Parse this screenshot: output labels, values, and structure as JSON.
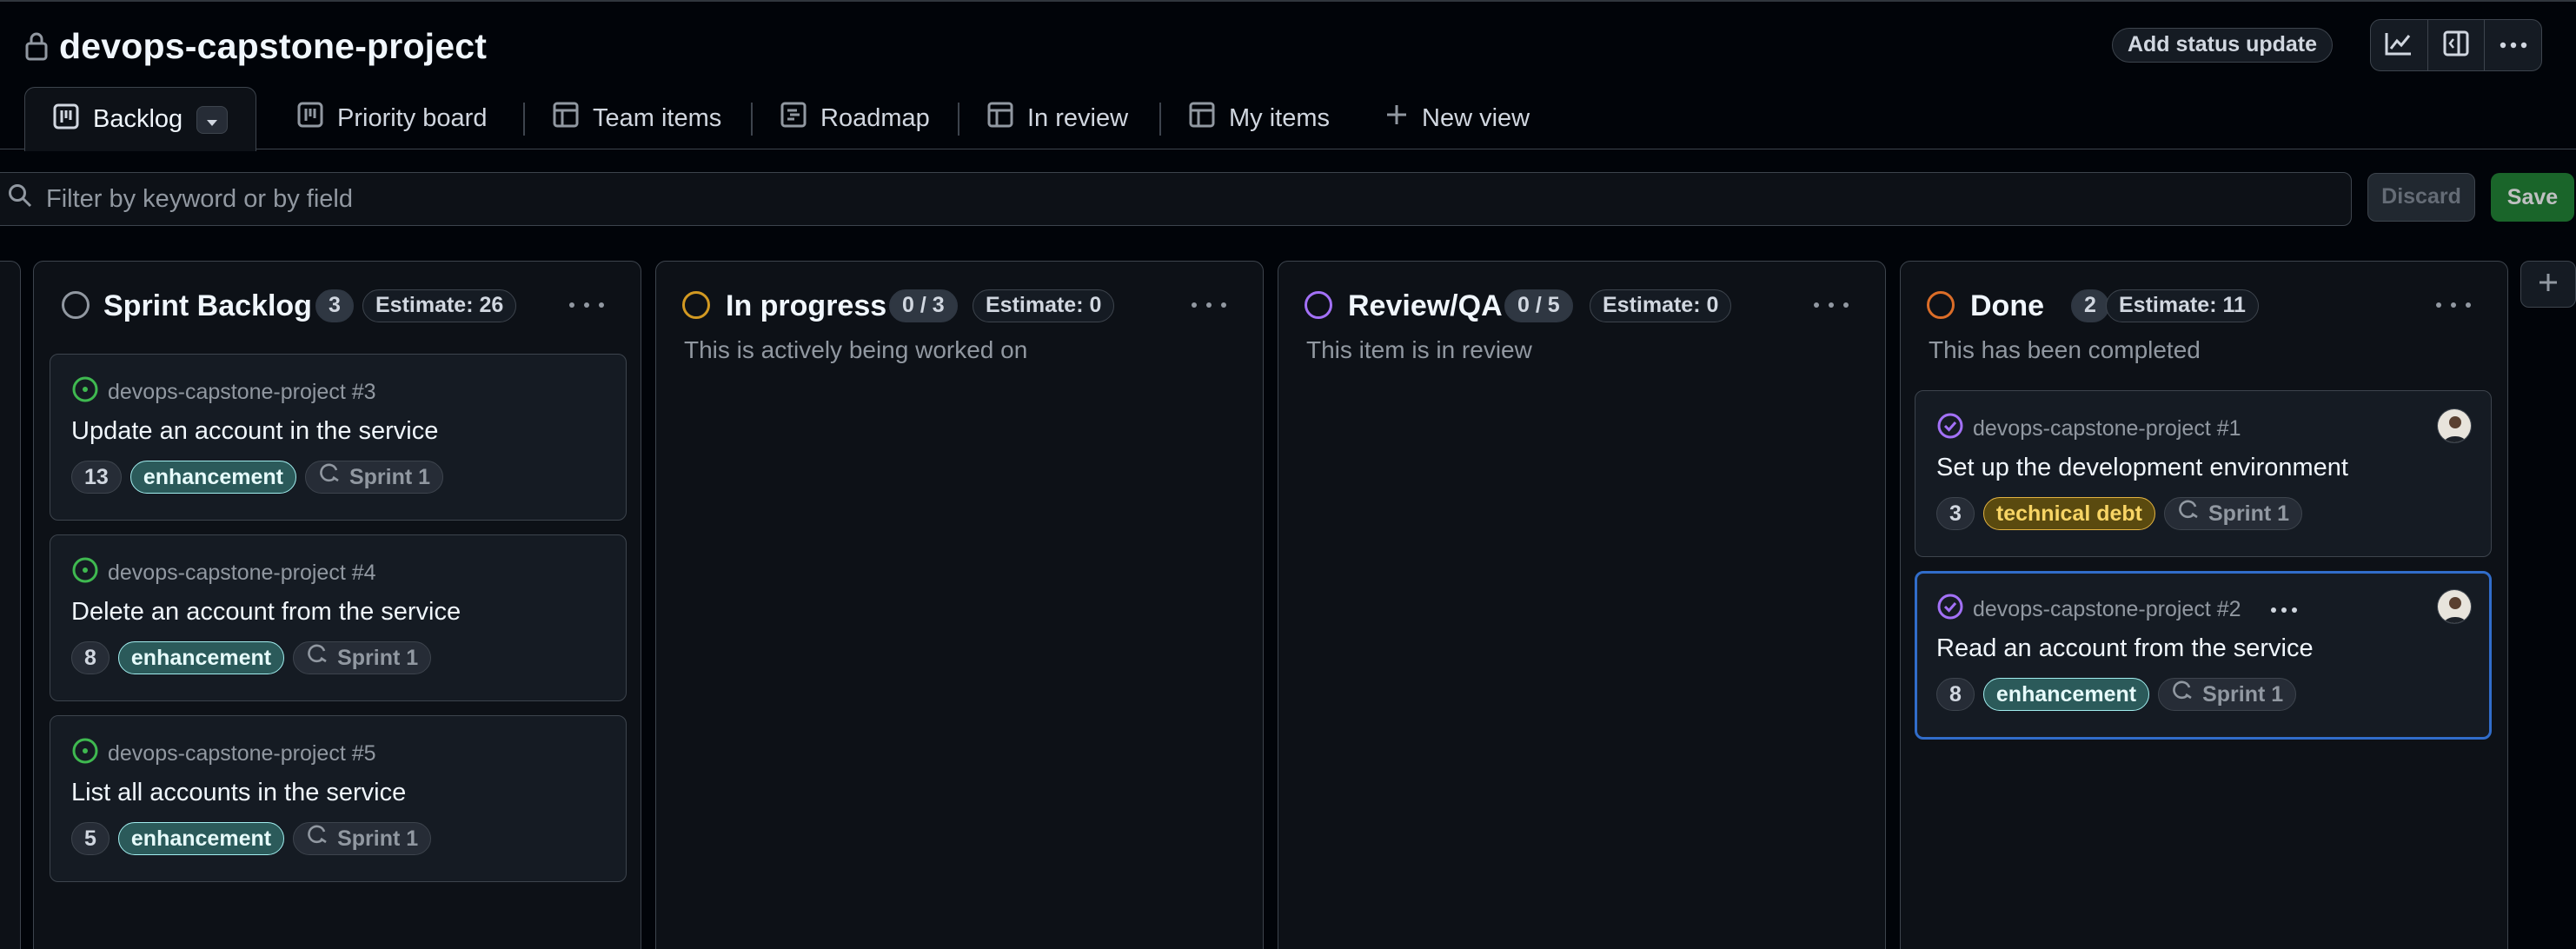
{
  "project": {
    "title": "devops-capstone-project"
  },
  "header": {
    "status_update_label": "Add status update"
  },
  "tabs": [
    {
      "label": "Backlog"
    },
    {
      "label": "Priority board"
    },
    {
      "label": "Team items"
    },
    {
      "label": "Roadmap"
    },
    {
      "label": "In review"
    },
    {
      "label": "My items"
    },
    {
      "label": "New view"
    }
  ],
  "filter": {
    "placeholder": "Filter by keyword or by field"
  },
  "actions": {
    "discard": "Discard",
    "save": "Save"
  },
  "columns": [
    {
      "title": "Sprint Backlog",
      "count": "3",
      "estimate": "Estimate: 26",
      "description": "",
      "status_color": "#9198a1",
      "cards": [
        {
          "ref": "devops-capstone-project #3",
          "title": "Update an account in the service",
          "points": "13",
          "label": "enhancement",
          "sprint": "Sprint 1",
          "state": "open"
        },
        {
          "ref": "devops-capstone-project #4",
          "title": "Delete an account from the service",
          "points": "8",
          "label": "enhancement",
          "sprint": "Sprint 1",
          "state": "open"
        },
        {
          "ref": "devops-capstone-project #5",
          "title": "List all accounts in the service",
          "points": "5",
          "label": "enhancement",
          "sprint": "Sprint 1",
          "state": "open"
        }
      ]
    },
    {
      "title": "In progress",
      "count": "0 / 3",
      "estimate": "Estimate: 0",
      "description": "This is actively being worked on",
      "status_color": "#d29922",
      "cards": []
    },
    {
      "title": "Review/QA",
      "count": "0 / 5",
      "estimate": "Estimate: 0",
      "description": "This item is in review",
      "status_color": "#a371f7",
      "cards": []
    },
    {
      "title": "Done",
      "count": "2",
      "estimate": "Estimate: 11",
      "description": "This has been completed",
      "status_color": "#db6d28",
      "cards": [
        {
          "ref": "devops-capstone-project #1",
          "title": "Set up the development environment",
          "points": "3",
          "label": "technical debt",
          "sprint": "Sprint 1",
          "state": "closed"
        },
        {
          "ref": "devops-capstone-project #2",
          "title": "Read an account from the service",
          "points": "8",
          "label": "enhancement",
          "sprint": "Sprint 1",
          "state": "closed"
        }
      ]
    }
  ],
  "icons": {
    "lock": "lock-icon",
    "insights": "graph-icon",
    "panel": "sidebar-expand-icon",
    "more": "kebab-horizontal-icon",
    "board": "project-board-icon",
    "table": "table-icon",
    "roadmap": "roadmap-icon",
    "plus": "plus-icon",
    "search": "search-icon",
    "issue_open": "issue-opened-icon",
    "issue_closed": "issue-closed-icon",
    "iteration": "iterations-icon"
  },
  "colors": {
    "open": "#3fb950",
    "closed": "#a371f7",
    "selected_border": "#316dca",
    "save": "#238636"
  }
}
